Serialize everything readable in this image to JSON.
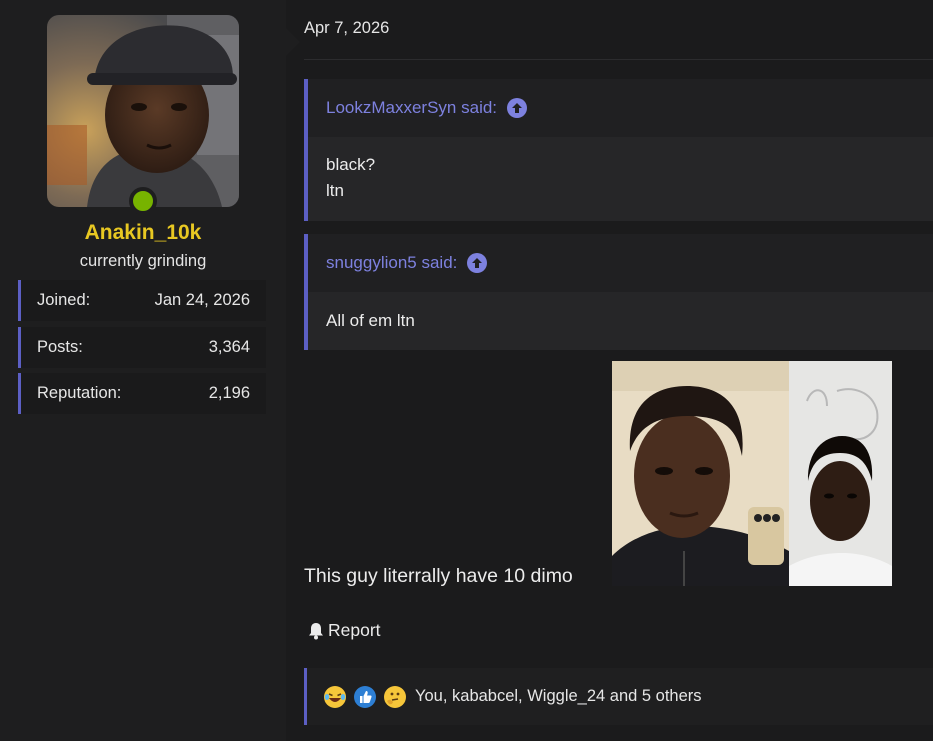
{
  "user": {
    "username": "Anakin_10k",
    "title": "currently grinding",
    "status_color": "#77b300",
    "stats": [
      {
        "label": "Joined:",
        "value": "Jan 24, 2026"
      },
      {
        "label": "Posts:",
        "value": "3,364"
      },
      {
        "label": "Reputation:",
        "value": "2,196"
      }
    ]
  },
  "post": {
    "date": "Apr 7, 2026",
    "quotes": [
      {
        "author_said": "LookzMaxxerSyn said:",
        "lines": [
          "black?",
          "ltn"
        ]
      },
      {
        "author_said": "snuggylion5 said:",
        "lines": [
          "All of em ltn"
        ]
      }
    ],
    "body_text": "This guy literrally have 10 dimo",
    "report_label": "Report",
    "reactions": {
      "icons": [
        "crying-laughing-emoji-icon",
        "thumbs-up-icon",
        "thinking-face-emoji-icon"
      ],
      "text": "You, kababcel, Wiggle_24 and 5 others"
    }
  },
  "colors": {
    "accent": "#5c5fc4",
    "quote_author": "#7d81df",
    "username": "#e8c822",
    "background": "#1b1b1c"
  }
}
